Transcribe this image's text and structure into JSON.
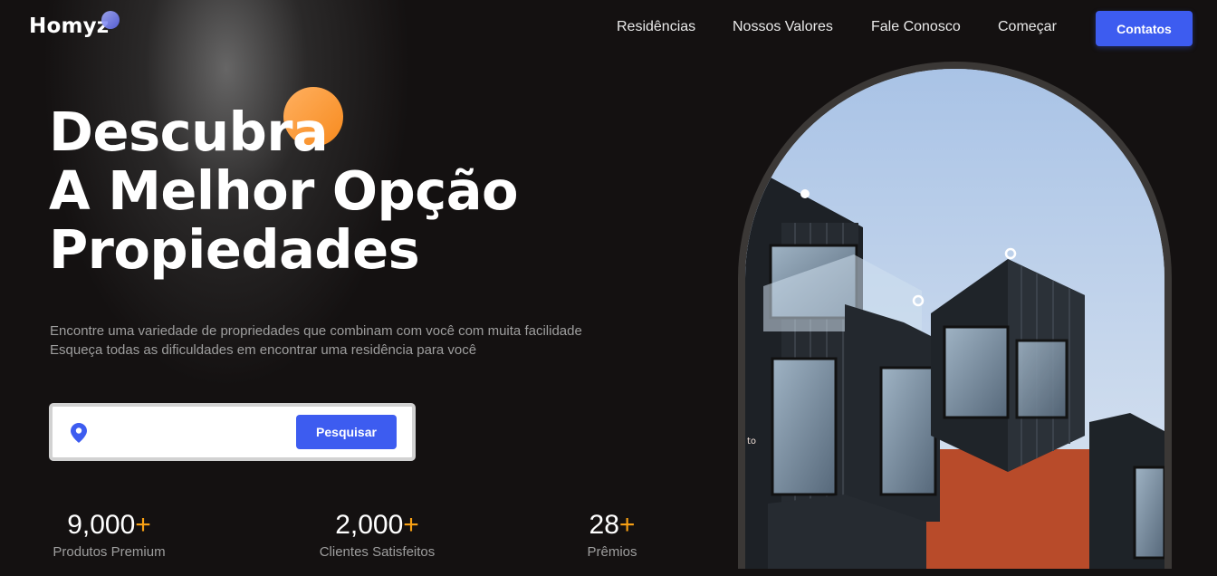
{
  "header": {
    "logo": "Homyz",
    "nav": [
      "Residências",
      "Nossos Valores",
      "Fale Conosco",
      "Começar"
    ],
    "contact_button": "Contatos"
  },
  "hero": {
    "title_lines": [
      "Descubra",
      "A Melhor Opção",
      "Propiedades"
    ],
    "description_lines": [
      "Encontre uma variedade de propriedades que combinam com você com muita facilidade",
      "Esqueça todas as dificuldades em encontrar uma residência para você"
    ],
    "search": {
      "placeholder": "",
      "button": "Pesquisar"
    },
    "stats": [
      {
        "value": "9,000",
        "suffix": "+",
        "label": "Produtos Premium"
      },
      {
        "value": "2,000",
        "suffix": "+",
        "label": "Clientes Satisfeitos"
      },
      {
        "value": "28",
        "suffix": "+",
        "label": "Prêmios"
      }
    ],
    "image_text": "to"
  },
  "colors": {
    "accent_blue": "#3d5cf0",
    "accent_orange": "#f7a014",
    "background": "#141111"
  },
  "icons": {
    "search_pin": "location-pin-icon"
  }
}
